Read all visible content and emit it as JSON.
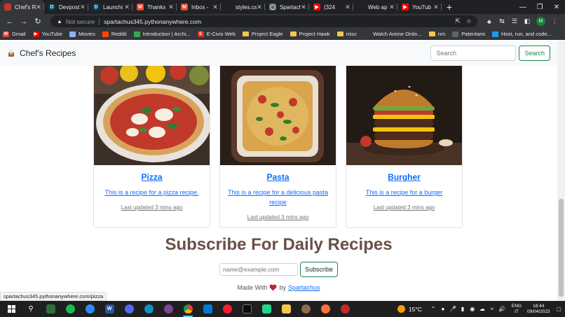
{
  "browser": {
    "tabs": [
      {
        "title": "Chef's R",
        "favicon_color": "#c0392b",
        "favicon_glyph": "",
        "active": true
      },
      {
        "title": "Devpost",
        "favicon_color": "#003e54",
        "favicon_glyph": "D",
        "active": false
      },
      {
        "title": "Launchi",
        "favicon_color": "#003e54",
        "favicon_glyph": "D",
        "active": false
      },
      {
        "title": "Thanks",
        "favicon_color": "#ea4335",
        "favicon_glyph": "M",
        "active": false
      },
      {
        "title": "Inbox -",
        "favicon_color": "#ea4335",
        "favicon_glyph": "M",
        "active": false
      },
      {
        "title": "styles.cs",
        "favicon_color": "#202124",
        "favicon_glyph": "",
        "active": false
      },
      {
        "title": "Spartach",
        "favicon_color": "#5f6368",
        "favicon_glyph": "◯",
        "active": false
      },
      {
        "title": "(324",
        "favicon_color": "#ff0000",
        "favicon_glyph": "▶",
        "active": false
      },
      {
        "title": "Web ap",
        "favicon_color": "#202124",
        "favicon_glyph": "",
        "active": false
      },
      {
        "title": "YouTub",
        "favicon_color": "#ff0000",
        "favicon_glyph": "▶",
        "active": false
      }
    ],
    "new_tab_icon": "plus-icon",
    "address": {
      "security_label": "Not secure",
      "url": "spartachus345.pythonanywhere.com"
    },
    "profile_initial": "M",
    "bookmarks": [
      {
        "label": "Gmail",
        "icon": "gmail-icon",
        "color": "#ea4335",
        "glyph": "M"
      },
      {
        "label": "YouTube",
        "icon": "youtube-icon",
        "color": "#ff0000",
        "glyph": "▶"
      },
      {
        "label": "Movies",
        "icon": "movies-icon",
        "color": "#8ab4f8",
        "glyph": ""
      },
      {
        "label": "Reddit",
        "icon": "reddit-icon",
        "color": "#ff4500",
        "glyph": ""
      },
      {
        "label": "Introduction | Archi...",
        "icon": "archi-icon",
        "color": "#34a853",
        "glyph": ""
      },
      {
        "label": "E-Civis Web",
        "icon": "ecivis-icon",
        "color": "#d93025",
        "glyph": "E"
      },
      {
        "label": "Project Eagle",
        "icon": "folder-icon",
        "color": "#f6c64e",
        "glyph": ""
      },
      {
        "label": "Project Hawk",
        "icon": "folder-icon",
        "color": "#f6c64e",
        "glyph": ""
      },
      {
        "label": "misc",
        "icon": "folder-icon",
        "color": "#f6c64e",
        "glyph": ""
      },
      {
        "label": "Watch Anime Onlin...",
        "icon": "anime-icon",
        "color": "#35363a",
        "glyph": ""
      },
      {
        "label": "nm",
        "icon": "folder-icon",
        "color": "#f6c64e",
        "glyph": ""
      },
      {
        "label": "Patentami",
        "icon": "patentami-icon",
        "color": "#5f6368",
        "glyph": ""
      },
      {
        "label": "Host, run, and code...",
        "icon": "pythonanywhere-icon",
        "color": "#1d9bf0",
        "glyph": ""
      }
    ]
  },
  "site": {
    "brand": "Chef's Recipes",
    "search_placeholder": "Search",
    "search_button": "Search",
    "cards": [
      {
        "title": "Pizza",
        "text": "This is a recipe for a pizza recipe.",
        "updated": "Last updated 3 mins ago",
        "image": "pizza-image"
      },
      {
        "title": "Pasta",
        "text": "This is a recipe for a delicious pasta recipe",
        "updated": "Last updated 3 mins ago",
        "image": "pasta-image"
      },
      {
        "title": "Burgher",
        "text": "This is a recipe for a burger",
        "updated": "Last updated 3 mins ago",
        "image": "burger-image"
      }
    ],
    "subscribe_heading": "Subscribe For Daily Recipes",
    "email_placeholder": "name@example.com",
    "subscribe_button": "Subscribe",
    "footer": {
      "prefix": "Made With",
      "by": "by",
      "author": "Spartachus"
    },
    "status_url": "spartachus345.pythonanywhere.com/pizza"
  },
  "taskbar": {
    "weather_temp": "15°C",
    "lang_line1": "ENG",
    "lang_line2": "IT",
    "time": "18:44",
    "date": "09/04/2023"
  }
}
